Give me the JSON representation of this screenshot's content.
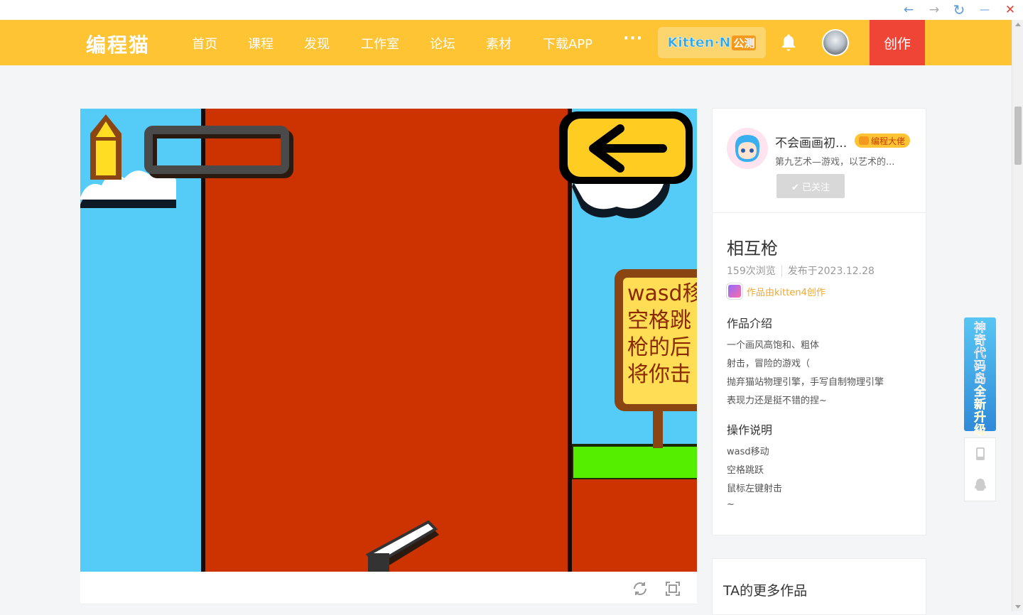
{
  "window": {
    "back_glyph": "←",
    "forward_glyph": "→",
    "refresh_glyph": "↻",
    "minimize_glyph": "—",
    "close_glyph": "✕"
  },
  "header": {
    "logo": "编程猫",
    "nav": [
      "首页",
      "课程",
      "发现",
      "工作室",
      "论坛",
      "素材",
      "下载APP"
    ],
    "more": "···",
    "kitten_label": "Kitten·N",
    "kitten_tag": "公测",
    "create_label": "创作",
    "colors": {
      "bar": "#fec433",
      "create": "#ef4537"
    }
  },
  "game": {
    "sign_lines": [
      "wasd移",
      "空格跳",
      "枪的后",
      "将你击"
    ],
    "colors": {
      "sky": "#55ccf7",
      "wall": "#cc3300",
      "grass": "#55ee00",
      "sign": "#ffdd55",
      "sign_border": "#8b4513"
    }
  },
  "author": {
    "name": "不会画画初...",
    "badge": "编程大佬",
    "bio": "第九艺术—游戏，以艺术的...",
    "follow_label": "✔ 已关注"
  },
  "work": {
    "title": "相互枪",
    "views": "159次浏览",
    "published": "发布于2023.12.28",
    "made_by": "作品由kitten4创作",
    "intro_title": "作品介绍",
    "intro_lines": [
      "一个画风高饱和、粗体",
      "射击，冒险的游戏（",
      "抛弃猫站物理引擎，手写自制物理引擎",
      "表现力还是挺不错的捏~"
    ],
    "ops_title": "操作说明",
    "ops_lines": [
      "wasd移动",
      "空格跳跃",
      "鼠标左键射击",
      "~"
    ]
  },
  "more": {
    "title": "TA的更多作品"
  },
  "promo": {
    "lines": [
      "神",
      "奇",
      "代",
      "码",
      "岛",
      "全",
      "新",
      "升",
      "级"
    ]
  }
}
